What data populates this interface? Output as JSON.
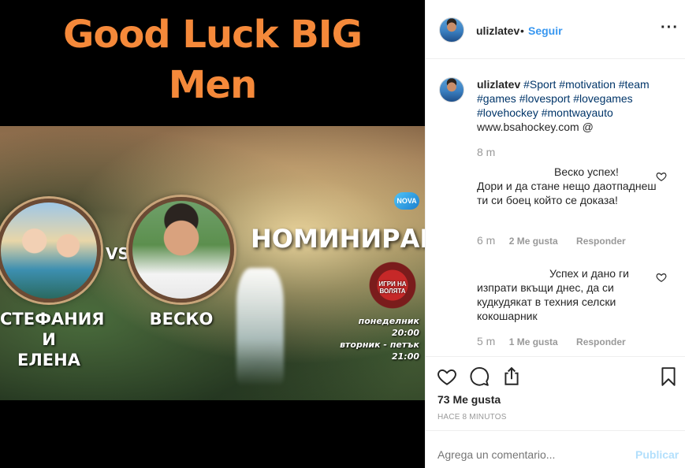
{
  "media": {
    "headline_line1": "Good Luck BIG",
    "headline_line2": "Men",
    "vs": "VS.",
    "name_left_line1": "СТЕФАНИЯ И",
    "name_left_line2": "ЕЛЕНА",
    "name_right": "ВЕСКО",
    "nominated": "НОМИНИРАНИ",
    "channel_logo": "NOVA",
    "show_logo": "ИГРИ НА ВОЛЯТА",
    "schedule_line1": "понеделник 20:00",
    "schedule_line2": "вторник - петък 21:00"
  },
  "header": {
    "username": "ulizlatev",
    "separator": "•",
    "follow_label": "Seguir",
    "more_icon": "more-horizontal-icon"
  },
  "caption": {
    "username": "ulizlatev",
    "tags": [
      "#Sport",
      "#motivation",
      "#team",
      "#games",
      "#lovesport",
      "#lovegames",
      "#lovehockey",
      "#montwayauto"
    ],
    "link": "www.bsahockey.com @",
    "time": "8 m"
  },
  "comments": [
    {
      "line1": "Веско успех!",
      "rest": "Дори и да стане нещо даотпаднеш ти си боец който се доказа!",
      "time": "6 m",
      "likes": "2 Me gusta",
      "reply": "Responder"
    },
    {
      "line1": "Успех и дано ги",
      "rest": "изпрати вкъщи днес, да си кудкудякат в техния селски кокошарник",
      "time": "5 m",
      "likes": "1 Me gusta",
      "reply": "Responder"
    }
  ],
  "actions": {
    "likes_count": "73 Me gusta",
    "posted_ago": "HACE 8 MINUTOS"
  },
  "add_comment": {
    "placeholder": "Agrega un comentario...",
    "publish_label": "Publicar"
  },
  "colors": {
    "link_blue": "#3897f0",
    "hashtag_blue": "#003569",
    "headline_orange": "#f5893a",
    "muted_gray": "#999999"
  }
}
